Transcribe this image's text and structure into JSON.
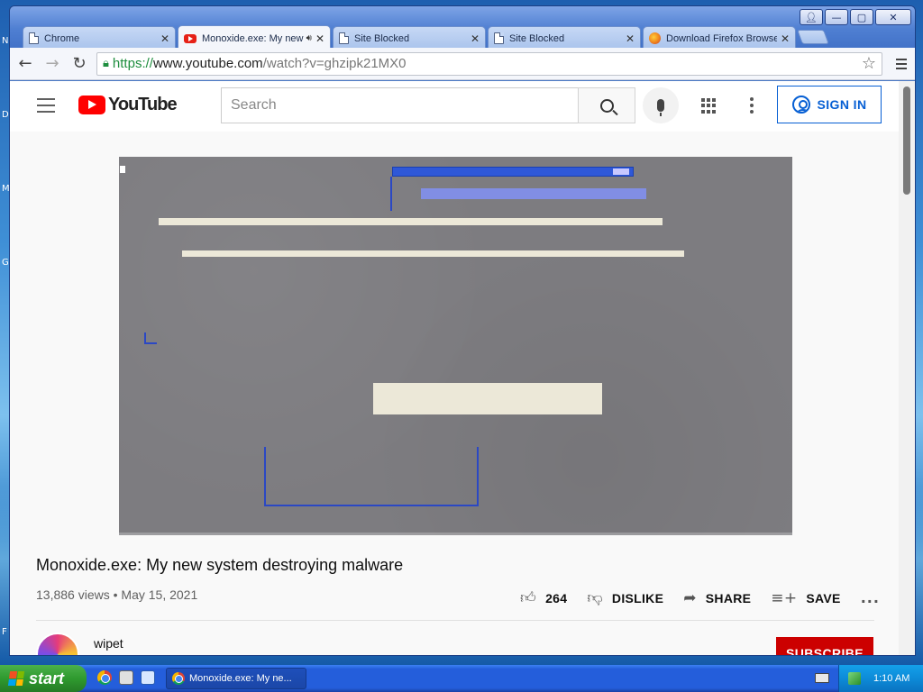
{
  "desktop": {
    "edge_letters": [
      "N",
      "D",
      "M",
      "G",
      "F"
    ]
  },
  "browser": {
    "tabs": [
      {
        "title": "Chrome",
        "favicon": "page-icon",
        "active": false
      },
      {
        "title": "Monoxide.exe: My new system destroying malware",
        "favicon": "youtube-icon",
        "active": true,
        "audio": true
      },
      {
        "title": "Site Blocked",
        "favicon": "page-icon",
        "active": false
      },
      {
        "title": "Site Blocked",
        "favicon": "page-icon",
        "active": false
      },
      {
        "title": "Download Firefox Browser",
        "favicon": "firefox-icon",
        "active": false
      }
    ],
    "url": {
      "scheme": "https://",
      "host": "www.youtube.com",
      "path": "/watch?v=ghzipk21MX0"
    }
  },
  "youtube": {
    "logo_text": "YouTube",
    "search_placeholder": "Search",
    "sign_in_label": "SIGN IN",
    "video": {
      "title": "Monoxide.exe: My new system destroying malware",
      "views": "13,886 views",
      "separator": "•",
      "date": "May 15, 2021"
    },
    "actions": {
      "likes": "264",
      "dislike_label": "DISLIKE",
      "share_label": "SHARE",
      "save_label": "SAVE",
      "more": "..."
    },
    "channel": {
      "name": "wipet",
      "subscribe_label": "SUBSCRIBE"
    }
  },
  "taskbar": {
    "start_label": "start",
    "task_title": "Monoxide.exe: My ne...",
    "clock": "1:10 AM"
  },
  "colors": {
    "youtube_red": "#ff0000",
    "link_blue": "#065fd4",
    "subscribe_red": "#cc0000",
    "xp_taskbar": "#245edb",
    "xp_start": "#2f9a2f"
  }
}
